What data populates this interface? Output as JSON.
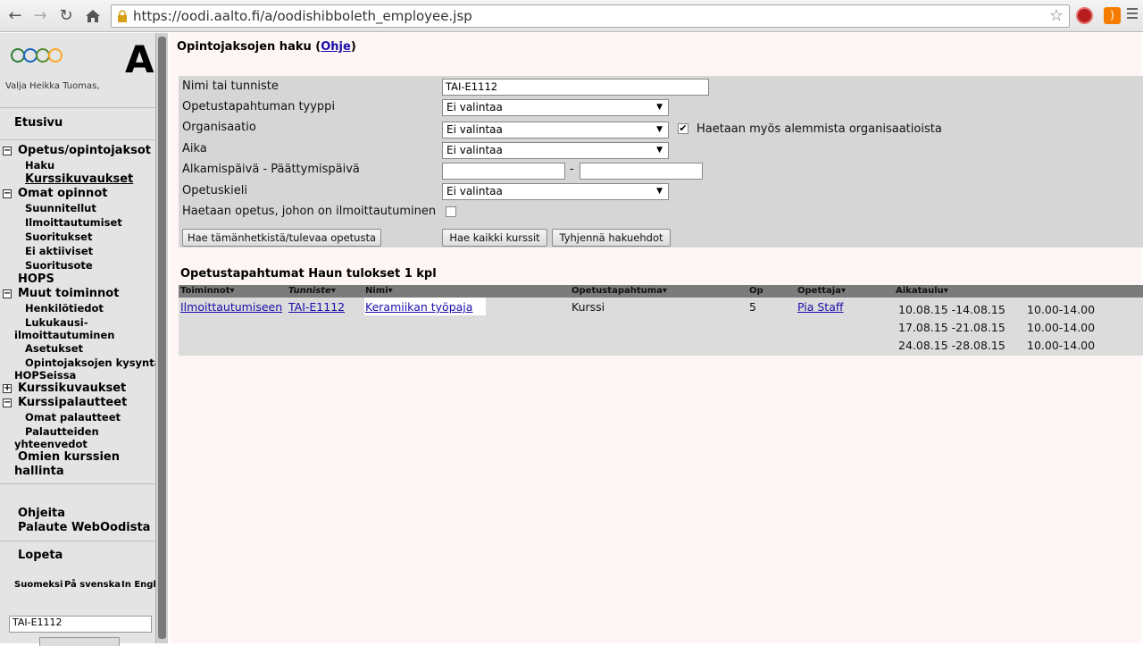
{
  "browser": {
    "url": "https://oodi.aalto.fi/a/oodishibboleth_employee.jsp",
    "back_icon": "arrow-left-icon",
    "forward_icon": "arrow-right-icon",
    "reload_icon": "reload-icon",
    "home_icon": "home-icon",
    "bookmark_icon": "star-icon"
  },
  "sidebar": {
    "logo_letter": "A",
    "user": "Valja Heikka Tuomas,",
    "front_page": "Etusivu",
    "sections": [
      {
        "label": "Opetus/opintojaksot",
        "items": [
          "Haku",
          "Kurssikuvaukset"
        ]
      },
      {
        "label": "Omat opinnot",
        "items": [
          "Suunnitellut",
          "Ilmoittautumiset",
          "Suoritukset",
          "Ei aktiiviset",
          "Suoritusote"
        ]
      }
    ],
    "hops": "HOPS",
    "other": {
      "label": "Muut toiminnot",
      "items": [
        "Henkilötiedot",
        "Lukukausi-",
        "ilmoittautuminen",
        "Asetukset",
        "Opintojaksojen kysyntä",
        "HOPSeissa"
      ]
    },
    "course_descriptions": "Kurssikuvaukset",
    "course_feedback": {
      "label": "Kurssipalautteet",
      "items": [
        "Omat palautteet",
        "Palautteiden",
        "yhteenvedot"
      ]
    },
    "own_courses": [
      "Omien kurssien",
      "hallinta"
    ],
    "help": "Ohjeita",
    "feedback": "Palaute WebOodista",
    "logout": "Lopeta",
    "languages": [
      "Suomeksi",
      "På svenska",
      "In Engli"
    ],
    "search_value": "TAI-E1112"
  },
  "main": {
    "title": "Opintojaksojen haku (",
    "title_help": "Ohje",
    "title_end": ")",
    "form": {
      "name_label": "Nimi tai tunniste",
      "name_value": "TAI-E1112",
      "type_label": "Opetustapahtuman tyyppi",
      "type_value": "Ei valintaa",
      "org_label": "Organisaatio",
      "org_value": "Ei valintaa",
      "sub_orgs_label": "Haetaan myös alemmista organisaatioista",
      "sub_orgs_checked": "✔",
      "time_label": "Aika",
      "time_value": "Ei valintaa",
      "dates_label": "Alkamispäivä - Päättymispäivä",
      "dates_dash": "-",
      "lang_label": "Opetuskieli",
      "lang_value": "Ei valintaa",
      "enrolled_label": "Haetaan opetus, johon on ilmoittautuminen",
      "btn_current": "Hae tämänhetkistä/tulevaa opetusta",
      "btn_all": "Hae kaikki kurssit",
      "btn_clear": "Tyhjennä hakuehdot"
    },
    "results": {
      "title": "Opetustapahtumat Haun tulokset 1 kpl",
      "headers": [
        "Toiminnot",
        "Tunniste",
        "Nimi",
        "Opetustapahtuma",
        "Op",
        "Opettaja",
        "Aikataulu"
      ],
      "row": {
        "action": "Ilmoittautumiseen",
        "code": "TAI-E1112",
        "name": "Keramiikan työpaja",
        "type": "Kurssi",
        "credits": "5",
        "teacher": "Pia Staff",
        "schedule": [
          {
            "dates": "10.08.15 -14.08.15",
            "time": "10.00-14.00"
          },
          {
            "dates": "17.08.15 -21.08.15",
            "time": "10.00-14.00"
          },
          {
            "dates": "24.08.15 -28.08.15",
            "time": "10.00-14.00"
          }
        ]
      }
    }
  }
}
